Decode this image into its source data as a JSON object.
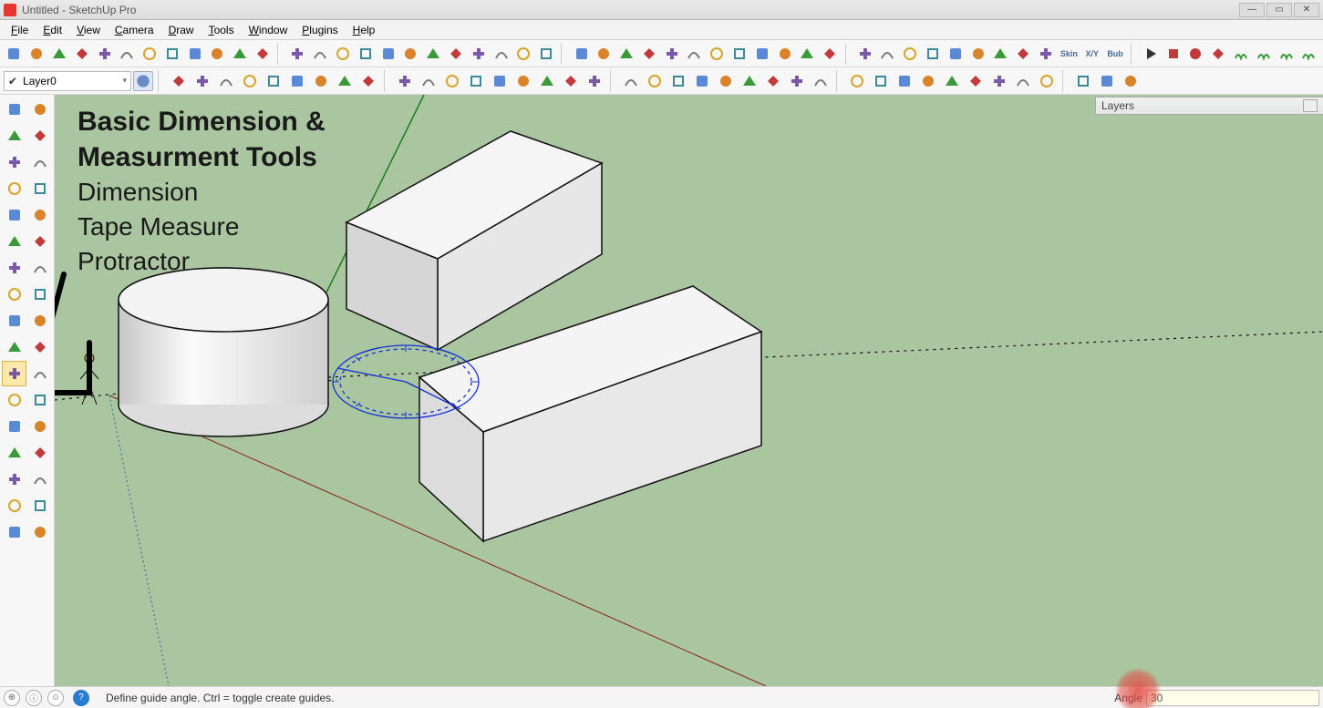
{
  "title": "Untitled - SketchUp Pro",
  "menus": [
    "File",
    "Edit",
    "View",
    "Camera",
    "Draw",
    "Tools",
    "Window",
    "Plugins",
    "Help"
  ],
  "layer_selector": {
    "name": "Layer0"
  },
  "top1_icons": [
    "select-arrow",
    "arc",
    "freehand",
    "move-axis",
    "rectangle",
    "circle",
    "rotate",
    "pushpull",
    "offset",
    "paint-bucket",
    "follow-me",
    "line",
    "2pt-arc",
    "polygon",
    "eraser",
    "tape",
    "dimension",
    "text",
    "protractor",
    "axes",
    "section",
    "scene-prev",
    "scene-next",
    "3d-warehouse",
    "orbit",
    "pan",
    "zoom",
    "zoom-extents",
    "zoom-window",
    "walk",
    "look",
    "position-camera",
    "shadow",
    "fog",
    "xray",
    "hidden-line",
    "shaded",
    "shaded-tex",
    "monochrome",
    "wireframe",
    "back-edges",
    "style1",
    "style2",
    "style3",
    "style4",
    "skin",
    "xy",
    "bub",
    "play",
    "stop-record",
    "record-red",
    "person",
    "grass-left",
    "grass-mid",
    "grass-right",
    "tree"
  ],
  "top1_text_icons": {
    "skin": "Skin",
    "xy": "X/Y",
    "bub": "Bub"
  },
  "top2_icons": [
    "component",
    "sphere",
    "star",
    "paint-group",
    "ruler",
    "toggle",
    "m-orange",
    "g-orange",
    "r-blue",
    "rt-blue",
    "br-blue",
    "q-blue",
    "h-orange",
    "circle-small",
    "dash",
    "cross",
    "tree1",
    "tree2",
    "coin",
    "pause",
    "dot-orange",
    "flag",
    "tri",
    "house-orange",
    "rotate-orange",
    "cube1",
    "stack",
    "cube2",
    "cube3",
    "cube4",
    "cube5",
    "cube6",
    "panel1",
    "panel2",
    "person2",
    "globe",
    "box1",
    "box2",
    "box3"
  ],
  "left_tools": [
    [
      "select",
      "component-icon"
    ],
    [
      "paint",
      "eraser"
    ],
    [
      "rectangle",
      "line"
    ],
    [
      "circle",
      "arc"
    ],
    [
      "polygon",
      "freehand"
    ],
    [
      "curve",
      "pie"
    ],
    [
      "move",
      "rotate"
    ],
    [
      "scale",
      "pushpull"
    ],
    [
      "offset",
      "followme"
    ],
    [
      "tape-measure",
      "text"
    ],
    [
      "protractor-tool",
      "dimension-tool"
    ],
    [
      "axes",
      "section-tool"
    ],
    [
      "orbit",
      "pan-tool"
    ],
    [
      "zoom",
      "zoom-ext"
    ],
    [
      "position",
      "look"
    ],
    [
      "walk-tool",
      "eye"
    ],
    [
      "footprints",
      "rotate-view"
    ]
  ],
  "left_active_row": 10,
  "left_active_col": 0,
  "layers_panel": {
    "title": "Layers"
  },
  "overlay": {
    "heading1": "Basic Dimension &",
    "heading2": "Measurment Tools",
    "items": [
      "Dimension",
      "Tape Measure",
      "Protractor"
    ]
  },
  "status": {
    "hint": "Define guide angle.  Ctrl = toggle create guides.",
    "vcb_label": "Angle",
    "vcb_value": "30"
  }
}
